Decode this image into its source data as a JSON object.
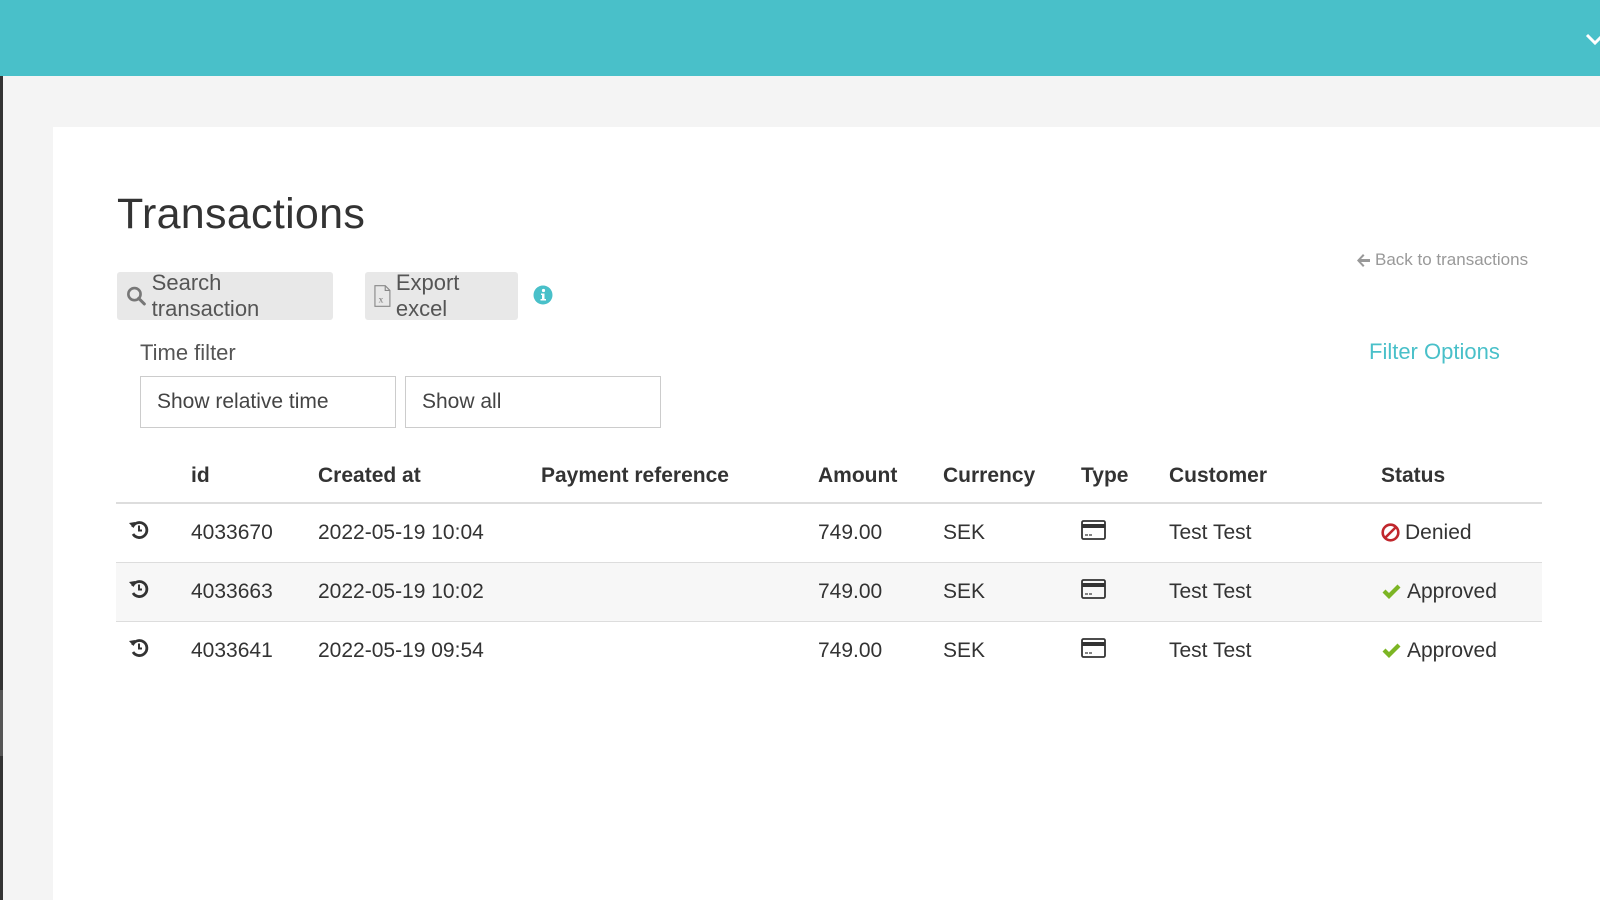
{
  "header": {
    "menu_icon": "chevron-down-icon"
  },
  "page": {
    "title": "Transactions",
    "back_link": "Back to transactions",
    "back_icon": "arrow-left-icon"
  },
  "toolbar": {
    "search_label": "Search transaction",
    "search_icon": "search-icon",
    "export_label": "Export excel",
    "export_icon": "excel-file-icon",
    "info_icon": "info-circle-icon"
  },
  "filters": {
    "time_filter_label": "Time filter",
    "relative_time_value": "Show relative time",
    "range_value": "Show all",
    "filter_options_label": "Filter Options"
  },
  "colors": {
    "accent": "#49c0c9",
    "denied": "#c0272d",
    "approved": "#7cb524"
  },
  "table": {
    "columns": [
      "",
      "id",
      "Created at",
      "Payment reference",
      "Amount",
      "Currency",
      "Type",
      "Customer",
      "Status"
    ],
    "rows": [
      {
        "icon": "history-icon",
        "id": "4033670",
        "created_at": "2022-05-19 10:04",
        "payment_reference": "",
        "amount": "749.00",
        "currency": "SEK",
        "type_icon": "credit-card-icon",
        "customer": "Test Test",
        "status": "Denied",
        "status_icon": "ban-icon"
      },
      {
        "icon": "history-icon",
        "id": "4033663",
        "created_at": "2022-05-19 10:02",
        "payment_reference": "",
        "amount": "749.00",
        "currency": "SEK",
        "type_icon": "credit-card-icon",
        "customer": "Test Test",
        "status": "Approved",
        "status_icon": "check-icon"
      },
      {
        "icon": "history-icon",
        "id": "4033641",
        "created_at": "2022-05-19 09:54",
        "payment_reference": "",
        "amount": "749.00",
        "currency": "SEK",
        "type_icon": "credit-card-icon",
        "customer": "Test Test",
        "status": "Approved",
        "status_icon": "check-icon"
      }
    ]
  }
}
